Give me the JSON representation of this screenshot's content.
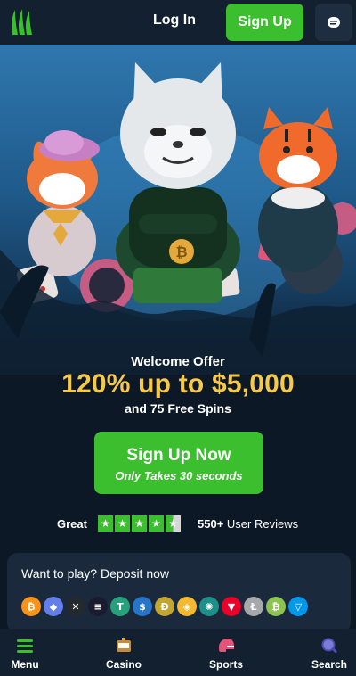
{
  "header": {
    "login_label": "Log In",
    "signup_label": "Sign Up",
    "logo_icon": "claw-logo-icon",
    "chat_icon": "chat-icon"
  },
  "promo": {
    "welcome": "Welcome Offer",
    "offer": "120% up to $5,000",
    "spins": "and 75 Free Spins",
    "cta_main": "Sign Up Now",
    "cta_sub": "Only Takes 30 seconds"
  },
  "rating": {
    "label": "Great",
    "stars": 4.5,
    "count": "550+",
    "reviews_label": "User Reviews"
  },
  "deposit": {
    "title": "Want to play? Deposit now",
    "coins": [
      {
        "name": "bitcoin-icon",
        "glyph": "₿",
        "color": "#f7931a"
      },
      {
        "name": "ethereum-icon",
        "glyph": "◆",
        "color": "#627eea"
      },
      {
        "name": "xrp-icon",
        "glyph": "✕",
        "color": "#23292f"
      },
      {
        "name": "solana-icon",
        "glyph": "≡",
        "color": "#1b1b2f"
      },
      {
        "name": "tether-icon",
        "glyph": "T",
        "color": "#26a17b"
      },
      {
        "name": "usdc-icon",
        "glyph": "$",
        "color": "#2775ca"
      },
      {
        "name": "dogecoin-icon",
        "glyph": "Ð",
        "color": "#c2a633"
      },
      {
        "name": "bnb-icon",
        "glyph": "◈",
        "color": "#f3ba2f"
      },
      {
        "name": "cardano-icon",
        "glyph": "✺",
        "color": "#1f8f8a"
      },
      {
        "name": "tron-icon",
        "glyph": "▼",
        "color": "#eb0029"
      },
      {
        "name": "litecoin-icon",
        "glyph": "Ł",
        "color": "#a6a9aa"
      },
      {
        "name": "bitcoin-cash-icon",
        "glyph": "₿",
        "color": "#8dc351"
      },
      {
        "name": "ton-icon",
        "glyph": "▽",
        "color": "#0098ea"
      }
    ]
  },
  "nav": {
    "menu": "Menu",
    "casino": "Casino",
    "sports": "Sports",
    "search": "Search"
  },
  "colors": {
    "accent_green": "#3bbf2e",
    "offer_gold": "#f6c94a",
    "background": "#0d1826",
    "header_bg": "#13202f"
  }
}
